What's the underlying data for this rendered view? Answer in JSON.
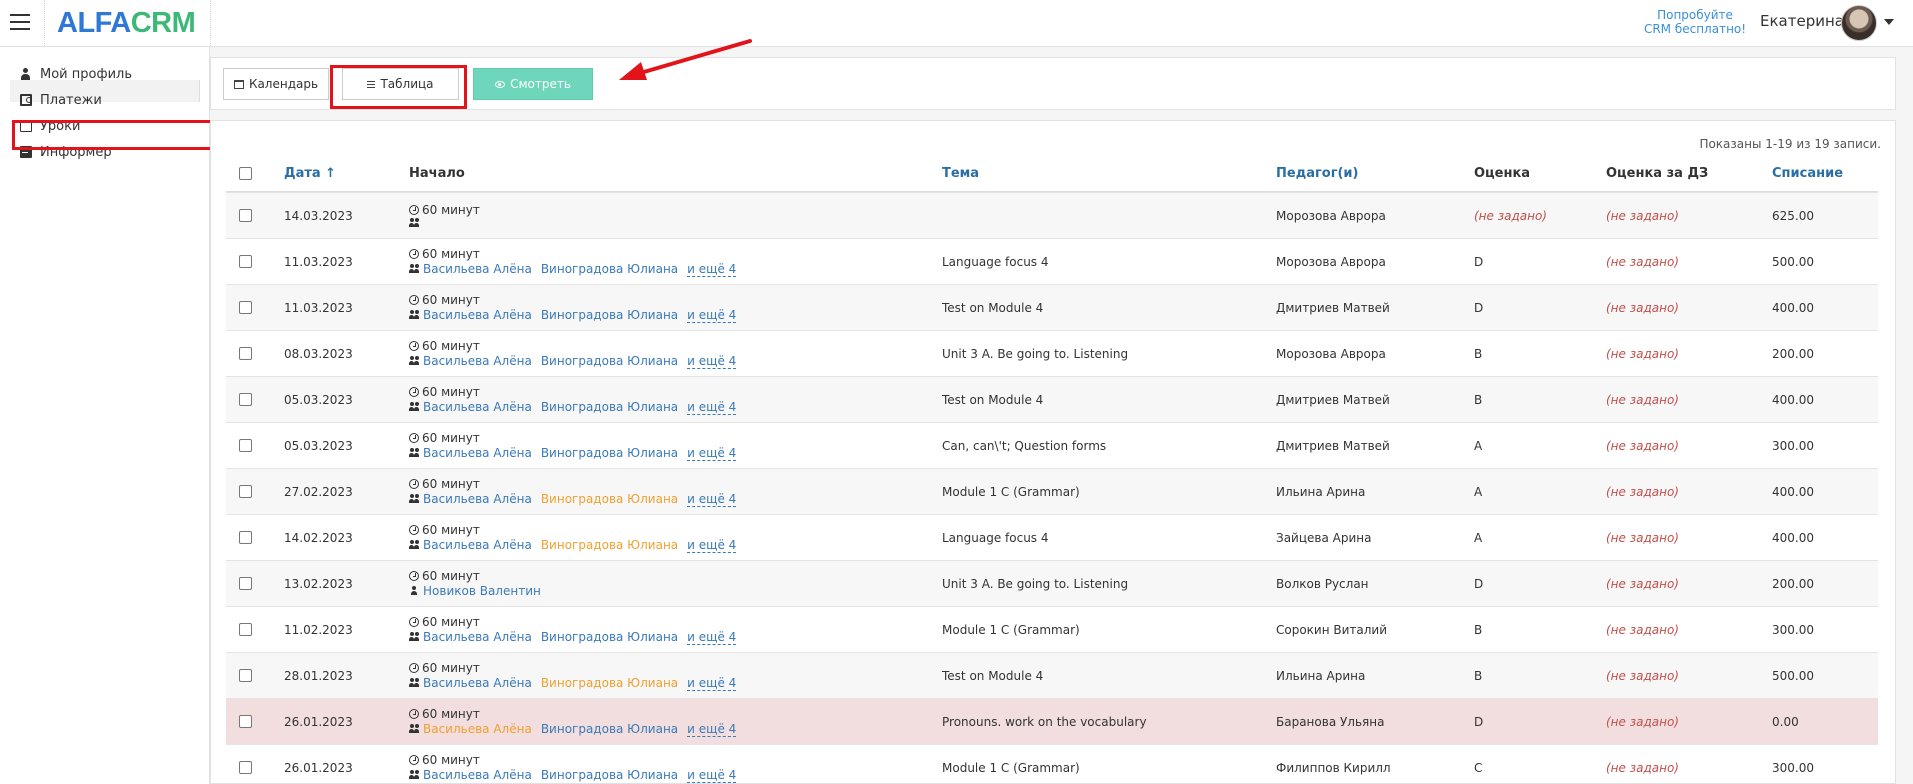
{
  "header": {
    "logo_part1": "ALFA",
    "logo_part2": "CRM",
    "try_line1": "Попробуйте",
    "try_line2": "CRM бесплатно!",
    "username": "Екатерина"
  },
  "sidebar": {
    "items": [
      {
        "label": "Мой профиль",
        "icon": "user-icon"
      },
      {
        "label": "Платежи",
        "icon": "money-icon"
      },
      {
        "label": "Уроки",
        "icon": "calendar-icon",
        "active": true
      },
      {
        "label": "Информер",
        "icon": "book-icon"
      }
    ]
  },
  "toolbar": {
    "calendar_label": "Календарь",
    "table_label": "Таблица",
    "view_label": "Смотреть"
  },
  "summary": "Показаны 1-19 из 19 записи.",
  "table": {
    "headers": {
      "date": "Дата ↑",
      "start": "Начало",
      "topic": "Тема",
      "teacher": "Педагог(и)",
      "grade": "Оценка",
      "hw_grade": "Оценка за ДЗ",
      "charge": "Списание"
    },
    "more_label": "и ещё 4",
    "rows": [
      {
        "date": "14.03.2023",
        "duration": "60 минут",
        "students": [],
        "more": false,
        "topic": "",
        "teacher": "Морозова Аврора",
        "grade": "(не задано)",
        "hw": "(не задано)",
        "charge": "625.00",
        "style": "alt"
      },
      {
        "date": "11.03.2023",
        "duration": "60 минут",
        "students": [
          "Васильева Алёна",
          "Виноградова Юлиана"
        ],
        "more": true,
        "topic": "Language focus 4",
        "teacher": "Морозова Аврора",
        "grade": "D",
        "hw": "(не задано)",
        "charge": "500.00",
        "style": ""
      },
      {
        "date": "11.03.2023",
        "duration": "60 минут",
        "students": [
          "Васильева Алёна",
          "Виноградова Юлиана"
        ],
        "more": true,
        "topic": "Test on Module 4",
        "teacher": "Дмитриев Матвей",
        "grade": "D",
        "hw": "(не задано)",
        "charge": "400.00",
        "style": "alt"
      },
      {
        "date": "08.03.2023",
        "duration": "60 минут",
        "students": [
          "Васильева Алёна",
          "Виноградова Юлиана"
        ],
        "more": true,
        "topic": "Unit 3 A. Be going to. Listening",
        "teacher": "Морозова Аврора",
        "grade": "B",
        "hw": "(не задано)",
        "charge": "200.00",
        "style": ""
      },
      {
        "date": "05.03.2023",
        "duration": "60 минут",
        "students": [
          "Васильева Алёна",
          "Виноградова Юлиана"
        ],
        "more": true,
        "topic": "Test on Module 4",
        "teacher": "Дмитриев Матвей",
        "grade": "B",
        "hw": "(не задано)",
        "charge": "400.00",
        "style": "alt"
      },
      {
        "date": "05.03.2023",
        "duration": "60 минут",
        "students": [
          "Васильева Алёна",
          "Виноградова Юлиана"
        ],
        "more": true,
        "topic": "Can, can\\'t; Question forms",
        "teacher": "Дмитриев Матвей",
        "grade": "A",
        "hw": "(не задано)",
        "charge": "300.00",
        "style": ""
      },
      {
        "date": "27.02.2023",
        "duration": "60 минут",
        "students": [
          "Васильева Алёна",
          "Виноградова Юлиана"
        ],
        "warn": [
          false,
          true
        ],
        "more": true,
        "topic": "Module 1 C (Grammar)",
        "teacher": "Ильина Арина",
        "grade": "A",
        "hw": "(не задано)",
        "charge": "400.00",
        "style": "alt"
      },
      {
        "date": "14.02.2023",
        "duration": "60 минут",
        "students": [
          "Васильева Алёна",
          "Виноградова Юлиана"
        ],
        "warn": [
          false,
          true
        ],
        "more": true,
        "topic": "Language focus 4",
        "teacher": "Зайцева Арина",
        "grade": "A",
        "hw": "(не задано)",
        "charge": "400.00",
        "style": ""
      },
      {
        "date": "13.02.2023",
        "duration": "60 минут",
        "students": [
          "Новиков Валентин"
        ],
        "single": true,
        "more": false,
        "topic": "Unit 3 A. Be going to. Listening",
        "teacher": "Волков Руслан",
        "grade": "D",
        "hw": "(не задано)",
        "charge": "200.00",
        "style": "alt"
      },
      {
        "date": "11.02.2023",
        "duration": "60 минут",
        "students": [
          "Васильева Алёна",
          "Виноградова Юлиана"
        ],
        "more": true,
        "topic": "Module 1 C (Grammar)",
        "teacher": "Сорокин Виталий",
        "grade": "B",
        "hw": "(не задано)",
        "charge": "300.00",
        "style": ""
      },
      {
        "date": "28.01.2023",
        "duration": "60 минут",
        "students": [
          "Васильева Алёна",
          "Виноградова Юлиана"
        ],
        "warn": [
          false,
          true
        ],
        "more": true,
        "topic": "Test on Module 4",
        "teacher": "Ильина Арина",
        "grade": "B",
        "hw": "(не задано)",
        "charge": "500.00",
        "style": "alt"
      },
      {
        "date": "26.01.2023",
        "duration": "60 минут",
        "students": [
          "Васильева Алёна",
          "Виноградова Юлиана"
        ],
        "warn": [
          true,
          false
        ],
        "more": true,
        "topic": "Pronouns. work on the vocabulary",
        "teacher": "Баранова Ульяна",
        "grade": "D",
        "hw": "(не задано)",
        "charge": "0.00",
        "style": "danger"
      },
      {
        "date": "26.01.2023",
        "duration": "60 минут",
        "students": [
          "Васильева Алёна",
          "Виноградова Юлиана"
        ],
        "more": true,
        "topic": "Module 1 C (Grammar)",
        "teacher": "Филиппов Кирилл",
        "grade": "C",
        "hw": "(не задано)",
        "charge": "300.00",
        "style": ""
      }
    ]
  },
  "colors": {
    "accent_link": "#3a7ab7",
    "view_button": "#6ed7bb",
    "highlight_red": "#e3131b",
    "danger_row": "#f2dede"
  }
}
